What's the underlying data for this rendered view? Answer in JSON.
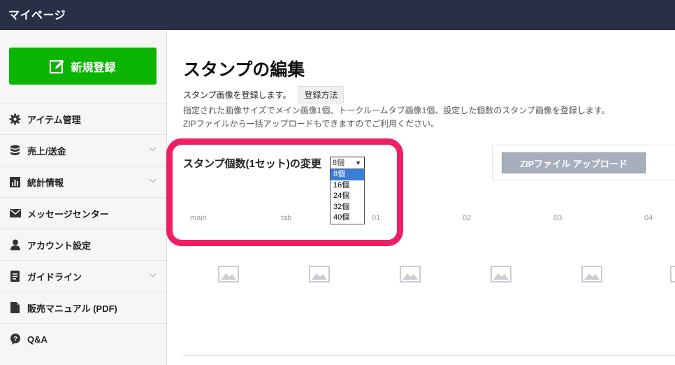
{
  "header": {
    "title": "マイページ"
  },
  "sidebar": {
    "new_button_label": "新規登録",
    "items": [
      {
        "label": "アイテム管理",
        "icon": "gear-icon",
        "expandable": false
      },
      {
        "label": "売上/送金",
        "icon": "coins-icon",
        "expandable": true
      },
      {
        "label": "統計情報",
        "icon": "bar-chart-icon",
        "expandable": true
      },
      {
        "label": "メッセージセンター",
        "icon": "envelope-icon",
        "expandable": false
      },
      {
        "label": "アカウント設定",
        "icon": "user-icon",
        "expandable": false
      },
      {
        "label": "ガイドライン",
        "icon": "document-icon",
        "expandable": true
      },
      {
        "label": "販売マニュアル (PDF)",
        "icon": "file-icon",
        "expandable": false
      },
      {
        "label": "Q&A",
        "icon": "question-bubble-icon",
        "expandable": false
      }
    ]
  },
  "main": {
    "title": "スタンプの編集",
    "intro": "スタンプ画像を登録します。",
    "howto_button": "登録方法",
    "desc_line1": "指定された画像サイズでメイン画像1個、トークルームタブ画像1個、設定した個数のスタンプ画像を登録します。",
    "desc_line2": "ZIPファイルから一括アップロードもできますのでご利用ください。",
    "count_label": "スタンプ個数(1セット)の変更",
    "count_selected": "8個",
    "count_options": [
      "8個",
      "16個",
      "24個",
      "32個",
      "40個"
    ],
    "zip_button": "ZIPファイル アップロード",
    "slots": [
      "main",
      "tab",
      "01",
      "02",
      "03",
      "04"
    ]
  }
}
